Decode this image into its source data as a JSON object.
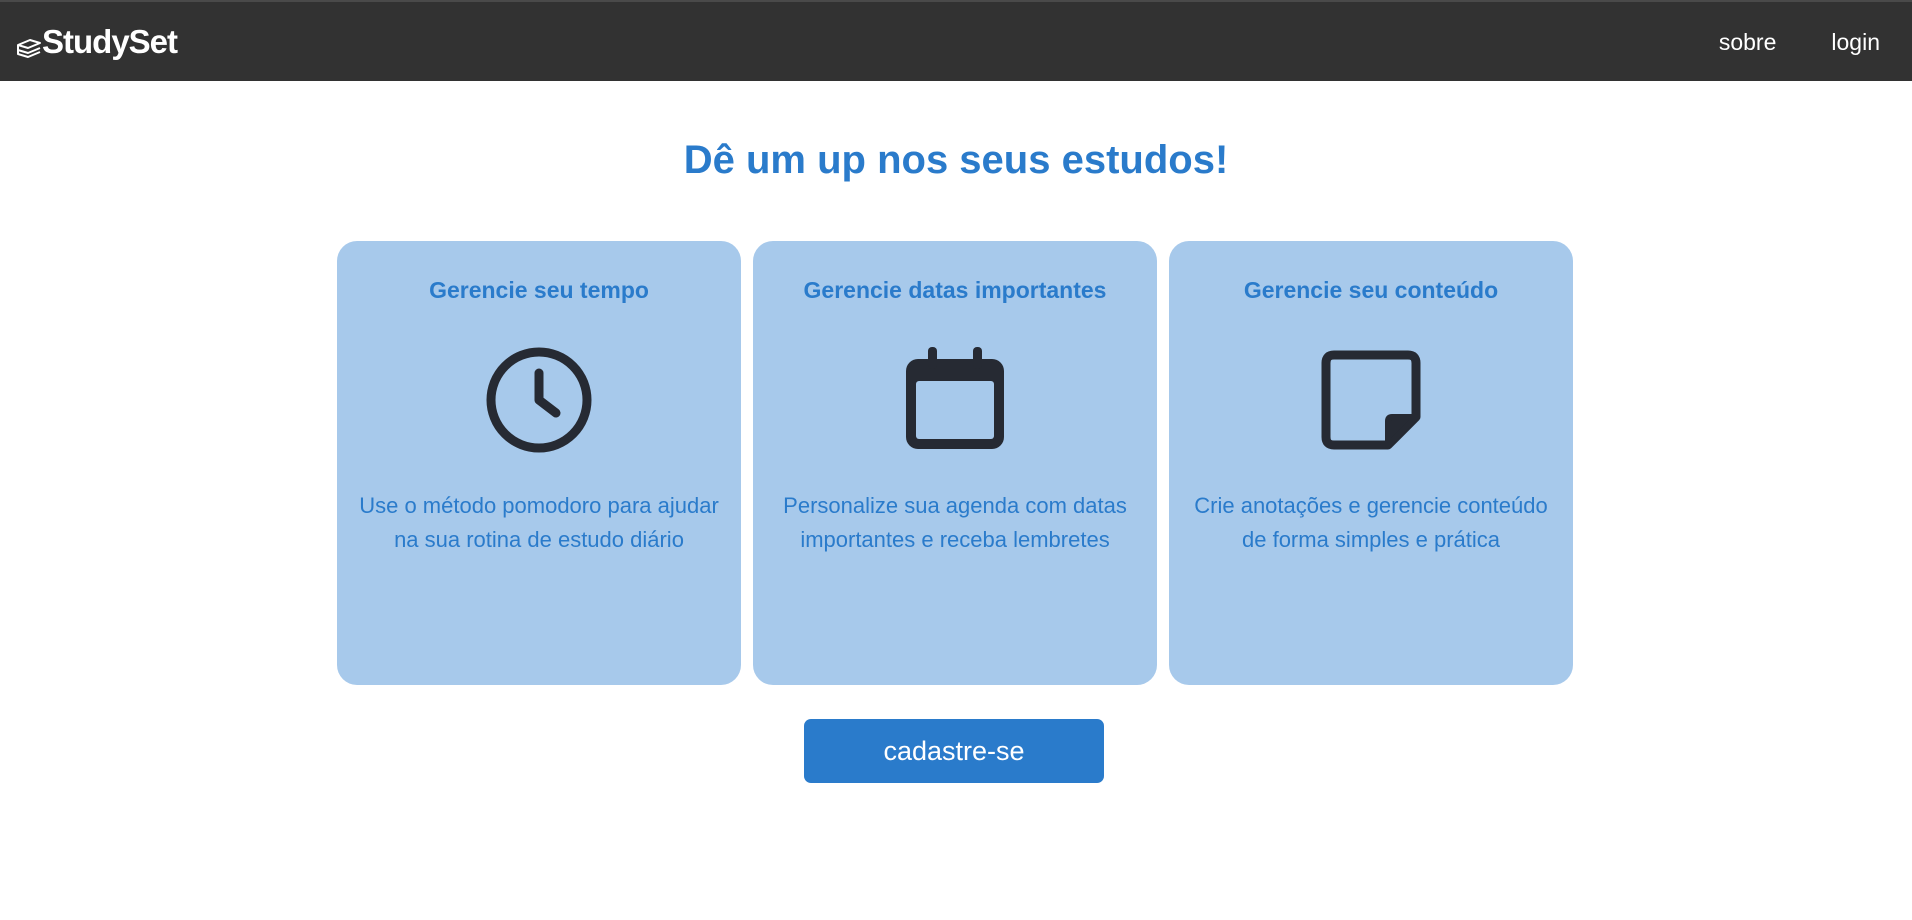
{
  "header": {
    "brand": "StudySet",
    "brand_icon": "stacked-books-icon",
    "nav": [
      {
        "label": "sobre"
      },
      {
        "label": "login"
      }
    ]
  },
  "main": {
    "headline": "Dê um up nos seus estudos!",
    "cards": [
      {
        "title": "Gerencie seu tempo",
        "icon": "clock-icon",
        "description": "Use o método pomodoro para ajudar na sua rotina de estudo diário"
      },
      {
        "title": "Gerencie datas importantes",
        "icon": "calendar-icon",
        "description": "Personalize sua agenda com datas importantes e receba lembretes"
      },
      {
        "title": "Gerencie seu conteúdo",
        "icon": "sticky-note-icon",
        "description": "Crie anotações e gerencie conteúdo de forma simples e prática"
      }
    ],
    "cta_label": "cadastre-se"
  },
  "colors": {
    "navbar": "#323232",
    "accent": "#2a7bcb",
    "card_background": "#a7c9eb",
    "icon": "#262a33"
  }
}
